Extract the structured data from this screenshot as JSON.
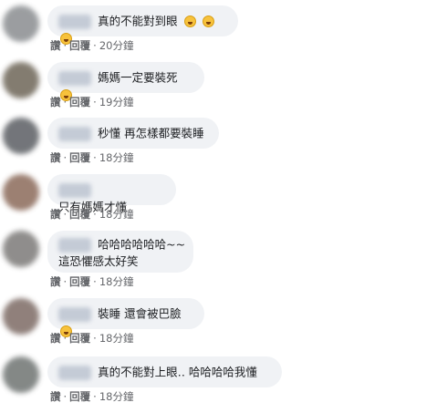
{
  "comments": [
    {
      "text": "真的不能對到眼",
      "emoji_count": 3,
      "emoji": "rofl-emoji",
      "like": "讚",
      "reply": "回覆",
      "time": "20分鐘"
    },
    {
      "text": "媽媽一定要裝死",
      "emoji_count": 1,
      "emoji": "laughing-emoji",
      "like": "讚",
      "reply": "回覆",
      "time": "19分鐘"
    },
    {
      "text": "秒懂 再怎樣都要裝睡",
      "emoji_count": 0,
      "emoji": "",
      "like": "讚",
      "reply": "回覆",
      "time": "18分鐘"
    },
    {
      "text": "只有媽媽才懂",
      "emoji_count": 0,
      "emoji": "",
      "like": "讚",
      "reply": "回覆",
      "time": "18分鐘"
    },
    {
      "text": "哈哈哈哈哈哈~~",
      "text2": "這恐懼感太好笑",
      "emoji_count": 0,
      "emoji": "",
      "like": "讚",
      "reply": "回覆",
      "time": "18分鐘"
    },
    {
      "text": "裝睡 還會被巴臉",
      "emoji_count": 1,
      "emoji": "laughing-emoji",
      "like": "讚",
      "reply": "回覆",
      "time": "18分鐘"
    },
    {
      "text": "真的不能對上眼‥ 哈哈哈哈我懂",
      "emoji_count": 0,
      "emoji": "",
      "like": "讚",
      "reply": "回覆",
      "time": "18分鐘"
    }
  ],
  "colors": {
    "bubble": "#f0f2f5",
    "meta": "#65676b",
    "text": "#1c1e21"
  }
}
